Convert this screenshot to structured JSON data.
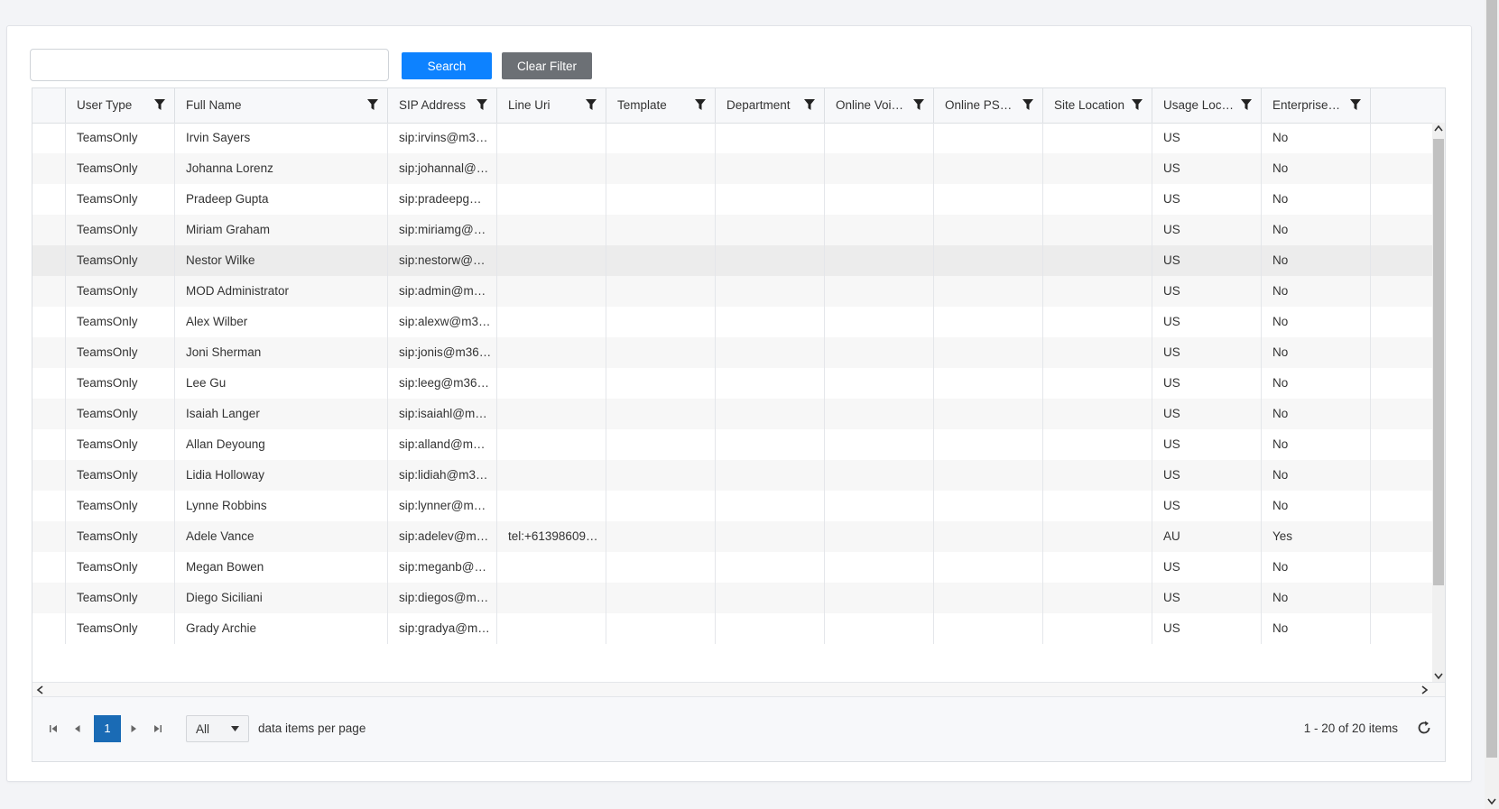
{
  "search": {
    "value": "",
    "placeholder": ""
  },
  "buttons": {
    "search_label": "Search",
    "clear_label": "Clear Filter"
  },
  "columns": [
    "User Type",
    "Full Name",
    "SIP Address",
    "Line Uri",
    "Template",
    "Department",
    "Online Voic…",
    "Online PST…",
    "Site Location",
    "Usage Loc…",
    "Enterprise…"
  ],
  "rows": [
    [
      "TeamsOnly",
      "Irvin Sayers",
      "sip:irvins@m3…",
      "",
      "",
      "",
      "",
      "",
      "",
      "US",
      "No"
    ],
    [
      "TeamsOnly",
      "Johanna Lorenz",
      "sip:johannal@…",
      "",
      "",
      "",
      "",
      "",
      "",
      "US",
      "No"
    ],
    [
      "TeamsOnly",
      "Pradeep Gupta",
      "sip:pradeepg…",
      "",
      "",
      "",
      "",
      "",
      "",
      "US",
      "No"
    ],
    [
      "TeamsOnly",
      "Miriam Graham",
      "sip:miriamg@…",
      "",
      "",
      "",
      "",
      "",
      "",
      "US",
      "No"
    ],
    [
      "TeamsOnly",
      "Nestor Wilke",
      "sip:nestorw@…",
      "",
      "",
      "",
      "",
      "",
      "",
      "US",
      "No"
    ],
    [
      "TeamsOnly",
      "MOD Administrator",
      "sip:admin@m…",
      "",
      "",
      "",
      "",
      "",
      "",
      "US",
      "No"
    ],
    [
      "TeamsOnly",
      "Alex Wilber",
      "sip:alexw@m3…",
      "",
      "",
      "",
      "",
      "",
      "",
      "US",
      "No"
    ],
    [
      "TeamsOnly",
      "Joni Sherman",
      "sip:jonis@m36…",
      "",
      "",
      "",
      "",
      "",
      "",
      "US",
      "No"
    ],
    [
      "TeamsOnly",
      "Lee Gu",
      "sip:leeg@m36…",
      "",
      "",
      "",
      "",
      "",
      "",
      "US",
      "No"
    ],
    [
      "TeamsOnly",
      "Isaiah Langer",
      "sip:isaiahl@m…",
      "",
      "",
      "",
      "",
      "",
      "",
      "US",
      "No"
    ],
    [
      "TeamsOnly",
      "Allan Deyoung",
      "sip:alland@m…",
      "",
      "",
      "",
      "",
      "",
      "",
      "US",
      "No"
    ],
    [
      "TeamsOnly",
      "Lidia Holloway",
      "sip:lidiah@m3…",
      "",
      "",
      "",
      "",
      "",
      "",
      "US",
      "No"
    ],
    [
      "TeamsOnly",
      "Lynne Robbins",
      "sip:lynner@m…",
      "",
      "",
      "",
      "",
      "",
      "",
      "US",
      "No"
    ],
    [
      "TeamsOnly",
      "Adele Vance",
      "sip:adelev@m…",
      "tel:+61398609…",
      "",
      "",
      "",
      "",
      "",
      "AU",
      "Yes"
    ],
    [
      "TeamsOnly",
      "Megan Bowen",
      "sip:meganb@…",
      "",
      "",
      "",
      "",
      "",
      "",
      "US",
      "No"
    ],
    [
      "TeamsOnly",
      "Diego Siciliani",
      "sip:diegos@m…",
      "",
      "",
      "",
      "",
      "",
      "",
      "US",
      "No"
    ],
    [
      "TeamsOnly",
      "Grady Archie",
      "sip:gradya@m…",
      "",
      "",
      "",
      "",
      "",
      "",
      "US",
      "No"
    ]
  ],
  "pager": {
    "current_page": "1",
    "page_size": "All",
    "per_page_label": "data items per page",
    "items_info": "1 - 20 of 20 items"
  },
  "colors": {
    "primary": "#0d82ff",
    "secondary": "#6c7075",
    "page_active": "#1a6bb5"
  },
  "icons": [
    "filter-icon",
    "first-page-icon",
    "prev-page-icon",
    "next-page-icon",
    "last-page-icon",
    "caret-down-icon",
    "refresh-icon"
  ]
}
